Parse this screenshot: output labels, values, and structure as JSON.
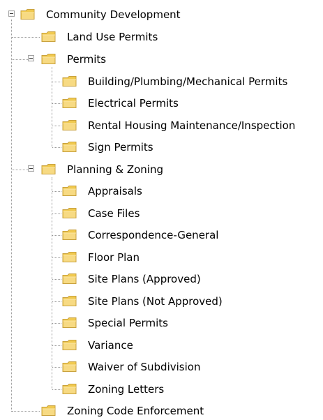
{
  "tree": {
    "root": {
      "label": "Community Development",
      "expanded": true
    },
    "level1": [
      {
        "label": "Land Use Permits"
      },
      {
        "label": "Permits",
        "expanded": true
      },
      {
        "label": "Planning & Zoning",
        "expanded": true
      },
      {
        "label": "Zoning Code Enforcement"
      }
    ],
    "permits_children": [
      {
        "label": "Building/Plumbing/Mechanical Permits"
      },
      {
        "label": "Electrical Permits"
      },
      {
        "label": "Rental Housing Maintenance/Inspection"
      },
      {
        "label": "Sign Permits"
      }
    ],
    "planning_children": [
      {
        "label": "Appraisals"
      },
      {
        "label": "Case Files"
      },
      {
        "label": "Correspondence-General"
      },
      {
        "label": "Floor Plan"
      },
      {
        "label": "Site Plans (Approved)"
      },
      {
        "label": "Site Plans (Not Approved)"
      },
      {
        "label": "Special Permits"
      },
      {
        "label": "Variance"
      },
      {
        "label": "Waiver of Subdivision"
      },
      {
        "label": "Zoning Letters"
      }
    ]
  },
  "colors": {
    "folder_fill": "#f5d67a",
    "folder_edge": "#c9a23f",
    "tree_line": "#9a9a9a"
  }
}
